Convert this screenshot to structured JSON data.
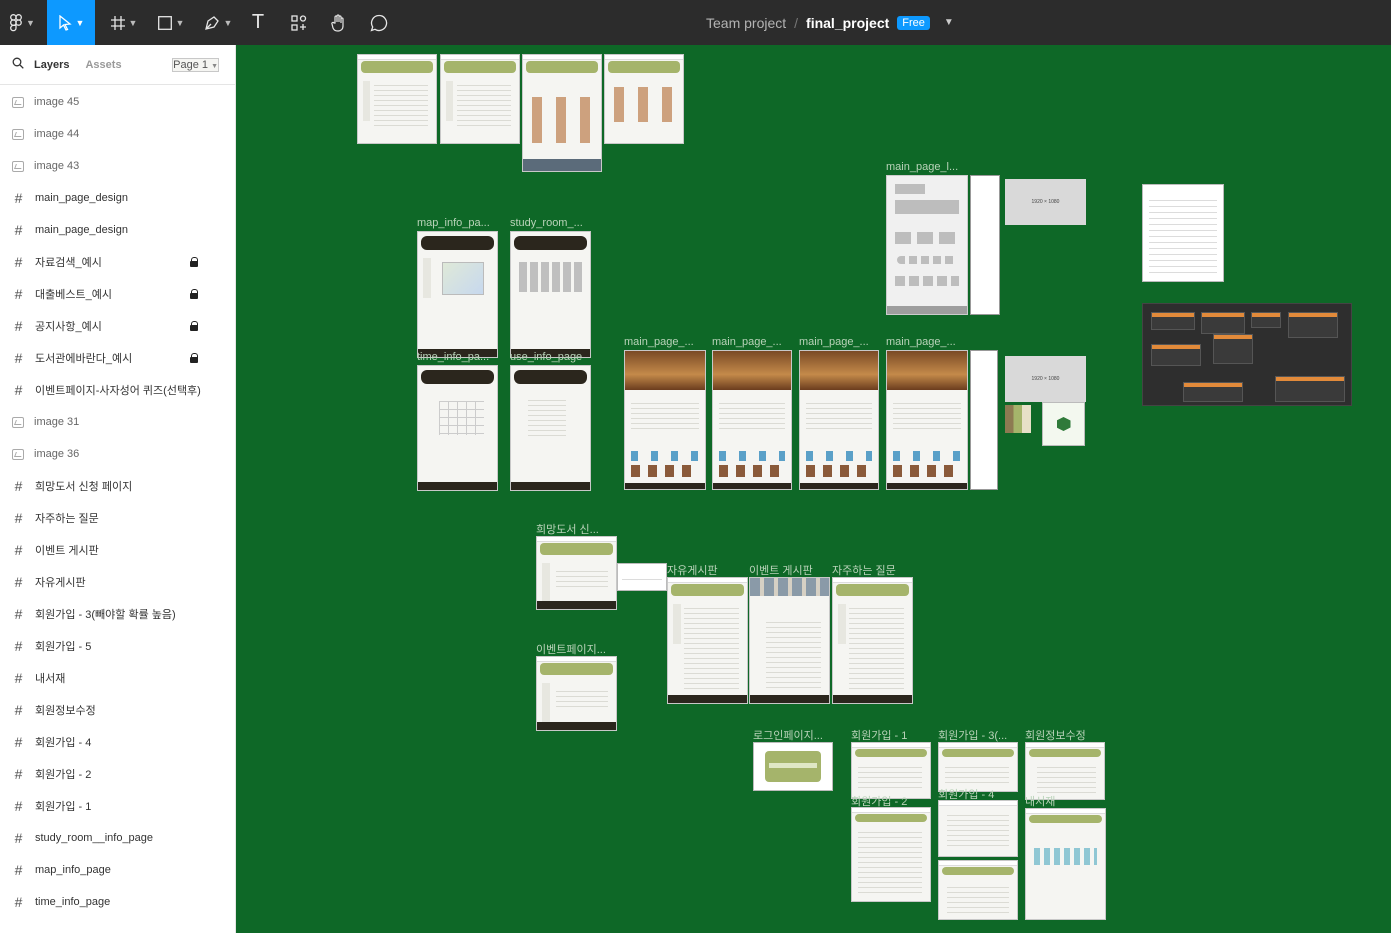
{
  "toolbar": {
    "tools": [
      "figma-menu-icon",
      "move-tool-icon",
      "frame-tool-icon",
      "shape-tool-icon",
      "pen-tool-icon",
      "text-tool-icon",
      "resources-icon",
      "hand-tool-icon",
      "comment-tool-icon"
    ],
    "text_tool_glyph": "T",
    "accent": "#0d99ff"
  },
  "file": {
    "team": "Team project",
    "separator": "/",
    "name": "final_project",
    "plan_badge": "Free"
  },
  "sidebar": {
    "tabs": [
      "Layers",
      "Assets"
    ],
    "active_tab": "Layers",
    "page_selector": "Page 1",
    "layers": [
      {
        "type": "image",
        "label": "image 45",
        "locked": false
      },
      {
        "type": "image",
        "label": "image 44",
        "locked": false
      },
      {
        "type": "image",
        "label": "image 43",
        "locked": false
      },
      {
        "type": "frame",
        "label": "main_page_design",
        "locked": false
      },
      {
        "type": "frame",
        "label": "main_page_design",
        "locked": false
      },
      {
        "type": "frame",
        "label": "자료검색_예시",
        "locked": true
      },
      {
        "type": "frame",
        "label": "대출베스트_예시",
        "locked": true
      },
      {
        "type": "frame",
        "label": "공지사항_예시",
        "locked": true
      },
      {
        "type": "frame",
        "label": "도서관에바란다_예시",
        "locked": true
      },
      {
        "type": "frame",
        "label": "이벤트페이지-사자성어 퀴즈(선택후)",
        "locked": false
      },
      {
        "type": "image",
        "label": "image 31",
        "locked": false
      },
      {
        "type": "image",
        "label": "image 36",
        "locked": false
      },
      {
        "type": "frame",
        "label": "희망도서 신청 페이지",
        "locked": false
      },
      {
        "type": "frame",
        "label": "자주하는 질문",
        "locked": false
      },
      {
        "type": "frame",
        "label": "이벤트 게시판",
        "locked": false
      },
      {
        "type": "frame",
        "label": "자유게시판",
        "locked": false
      },
      {
        "type": "frame",
        "label": "회원가입 - 3(빼야할 확률 높음)",
        "locked": false
      },
      {
        "type": "frame",
        "label": "회원가입 - 5",
        "locked": false
      },
      {
        "type": "frame",
        "label": "내서재",
        "locked": false
      },
      {
        "type": "frame",
        "label": "회원정보수정",
        "locked": false
      },
      {
        "type": "frame",
        "label": "회원가입 - 4",
        "locked": false
      },
      {
        "type": "frame",
        "label": "회원가입 - 2",
        "locked": false
      },
      {
        "type": "frame",
        "label": "회원가입 - 1",
        "locked": false
      },
      {
        "type": "frame",
        "label": "study_room__info_page",
        "locked": false
      },
      {
        "type": "frame",
        "label": "map_info_page",
        "locked": false
      },
      {
        "type": "frame",
        "label": "time_info_page",
        "locked": false
      }
    ]
  },
  "canvas": {
    "background": "#0e6827",
    "frame_labels": {
      "map": "map_info_pa...",
      "study": "study_room_...",
      "time": "time_info_pa...",
      "use": "use_info_page",
      "main_wire": "main_page_l...",
      "main1": "main_page_...",
      "main2": "main_page_...",
      "main3": "main_page_...",
      "main4": "main_page_...",
      "hope": "희망도서 신...",
      "event_page": "이벤트페이지...",
      "free_board": "자유게시판",
      "event_board": "이벤트 게시판",
      "faq": "자주하는 질문",
      "login": "로그인페이지...",
      "join1": "회원가입 - 1",
      "join3": "회원가입 - 3(...",
      "member_edit": "회원정보수정",
      "join2": "회원가입 - 2",
      "join4": "회원가입 - 4",
      "my_library": "내서재"
    },
    "placeholder_size": "1920 × 1080"
  }
}
